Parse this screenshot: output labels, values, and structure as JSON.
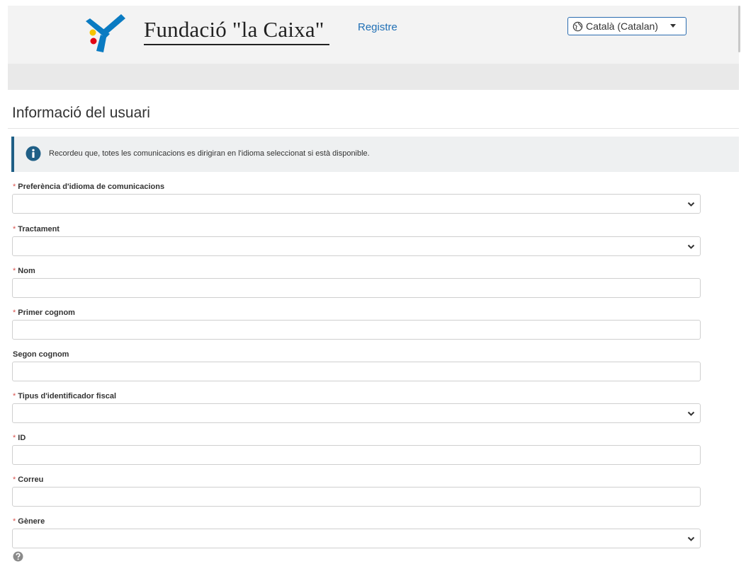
{
  "header": {
    "brand": "Fundació \"la Caixa\"",
    "register_link": "Registre",
    "language": {
      "selected": "Català (Catalan)",
      "icon": "globe-icon"
    },
    "colors": {
      "star_blue": "#0a7bc2",
      "star_yellow": "#f5c400",
      "star_red": "#e30613",
      "link": "#1f6fb5"
    }
  },
  "page": {
    "title": "Informació del usuari",
    "info_banner": {
      "icon": "info-icon",
      "text": "Recordeu que, totes les comunicacions es dirigiran en l'idioma seleccionat si està disponible."
    }
  },
  "form": {
    "required_marker": "*",
    "fields": [
      {
        "label": "Preferència d'idioma de comunicacions",
        "required": true,
        "type": "select",
        "value": ""
      },
      {
        "label": "Tractament",
        "required": true,
        "type": "select",
        "value": ""
      },
      {
        "label": "Nom",
        "required": true,
        "type": "text",
        "value": ""
      },
      {
        "label": "Primer cognom",
        "required": true,
        "type": "text",
        "value": ""
      },
      {
        "label": "Segon cognom",
        "required": false,
        "type": "text",
        "value": ""
      },
      {
        "label": "Tipus d'identificador fiscal",
        "required": true,
        "type": "select",
        "value": ""
      },
      {
        "label": "ID",
        "required": true,
        "type": "text",
        "value": ""
      },
      {
        "label": "Correu",
        "required": true,
        "type": "text",
        "value": ""
      },
      {
        "label": "Gènere",
        "required": true,
        "type": "select",
        "value": ""
      }
    ],
    "help_icon": "question-circle-icon"
  }
}
